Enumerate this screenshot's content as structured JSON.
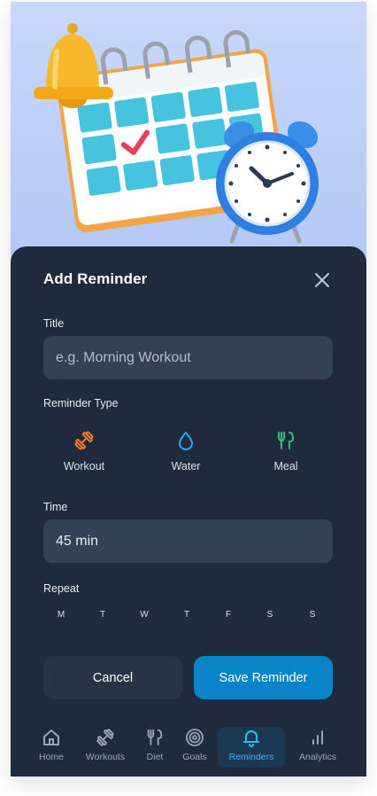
{
  "form": {
    "title": "Add Reminder",
    "title_label": "Title",
    "title_placeholder": "e.g. Morning Workout",
    "type_label": "Reminder Type",
    "types": [
      {
        "label": "Workout",
        "icon": "dumbbell-icon",
        "color": "#f07a2e"
      },
      {
        "label": "Water",
        "icon": "water-drop-icon",
        "color": "#2aa8f2"
      },
      {
        "label": "Meal",
        "icon": "fork-knife-icon",
        "color": "#2fc56f"
      }
    ],
    "time_label": "Time",
    "time_value": "45 min",
    "repeat_label": "Repeat",
    "days": [
      "M",
      "T",
      "W",
      "T",
      "F",
      "S",
      "S"
    ],
    "cancel_label": "Cancel",
    "save_label": "Save Reminder"
  },
  "nav": {
    "items": [
      {
        "label": "Home",
        "icon": "home-icon"
      },
      {
        "label": "Workouts",
        "icon": "dumbbell-icon"
      },
      {
        "label": "Diet",
        "icon": "fork-knife-icon"
      },
      {
        "label": "Goals",
        "icon": "target-icon"
      },
      {
        "label": "Reminders",
        "icon": "bell-icon",
        "active": true
      },
      {
        "label": "Analytics",
        "icon": "bar-chart-icon"
      }
    ]
  },
  "colors": {
    "sheet": "#1f2a3c",
    "field": "#334155",
    "accent": "#0a84c7",
    "active_nav": "#38b6f6"
  }
}
